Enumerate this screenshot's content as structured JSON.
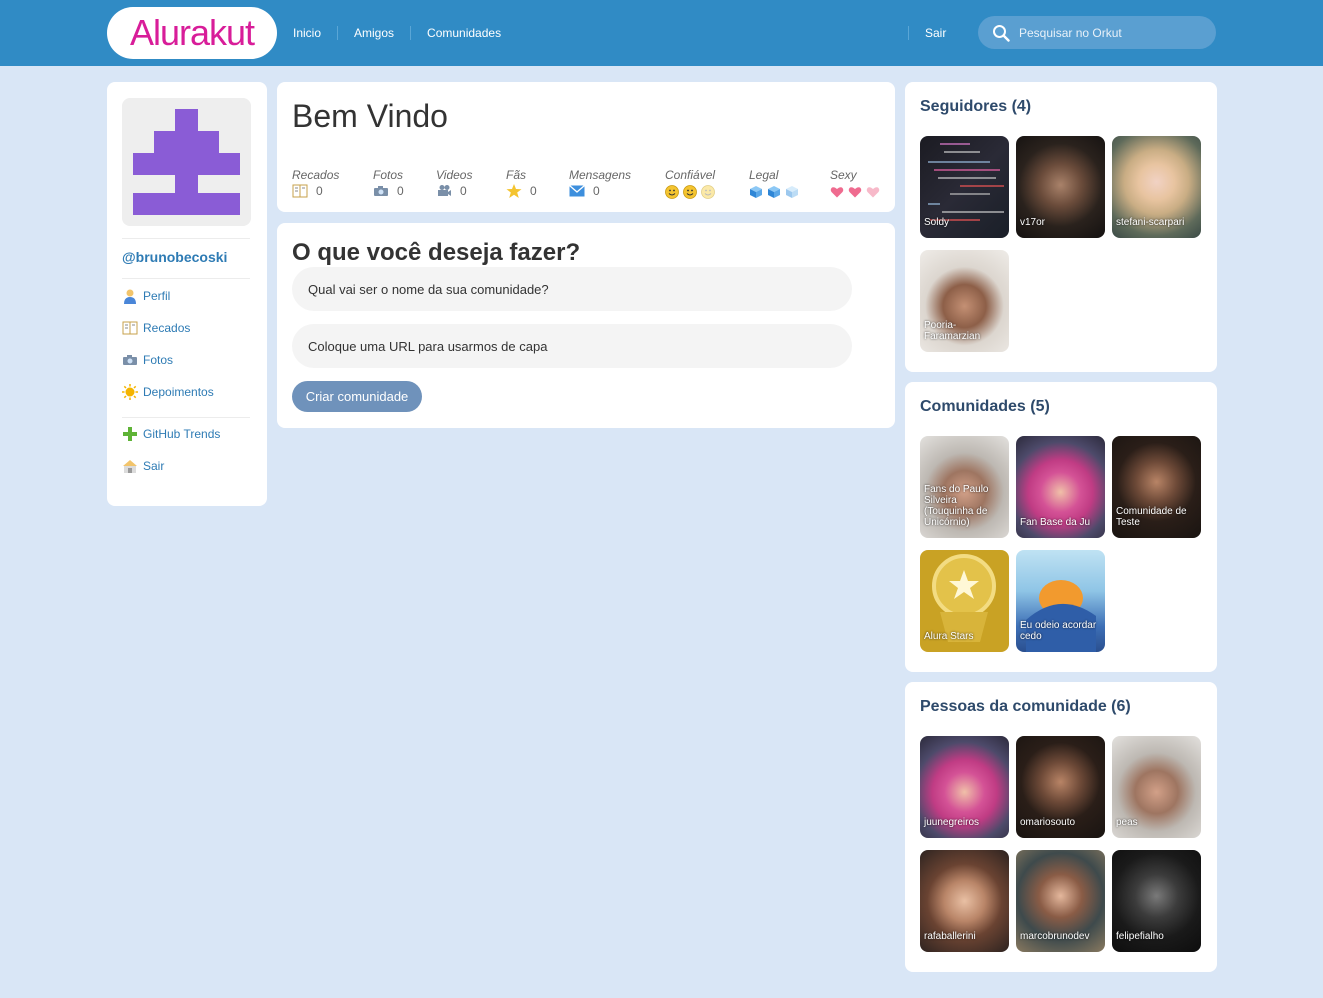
{
  "header": {
    "logo_text": "Alurakut",
    "nav": [
      "Inicio",
      "Amigos",
      "Comunidades"
    ],
    "logout": "Sair",
    "search_placeholder": "Pesquisar no Orkut"
  },
  "sidebar": {
    "username": "@brunobecoski",
    "menu": [
      {
        "label": "Perfil",
        "icon": "user-icon"
      },
      {
        "label": "Recados",
        "icon": "book-icon"
      },
      {
        "label": "Fotos",
        "icon": "camera-icon"
      },
      {
        "label": "Depoimentos",
        "icon": "sun-icon"
      }
    ],
    "menu2": [
      {
        "label": "GitHub Trends",
        "icon": "plus-icon"
      },
      {
        "label": "Sair",
        "icon": "home-icon"
      }
    ]
  },
  "welcome": {
    "title": "Bem Vindo",
    "stats": [
      {
        "label": "Recados",
        "value": "0",
        "icon": "book-icon"
      },
      {
        "label": "Fotos",
        "value": "0",
        "icon": "camera-icon"
      },
      {
        "label": "Videos",
        "value": "0",
        "icon": "video-icon"
      },
      {
        "label": "Fãs",
        "value": "0",
        "icon": "star-icon"
      },
      {
        "label": "Mensagens",
        "value": "0",
        "icon": "mail-icon"
      }
    ],
    "ratings": [
      {
        "label": "Confiável",
        "icon": "smiley-icon",
        "filled": 2,
        "total": 3
      },
      {
        "label": "Legal",
        "icon": "cube-icon",
        "filled": 2,
        "total": 3
      },
      {
        "label": "Sexy",
        "icon": "heart-icon",
        "filled": 2,
        "total": 3
      }
    ]
  },
  "form": {
    "title": "O que você deseja fazer?",
    "name_placeholder": "Qual vai ser o nome da sua comunidade?",
    "url_placeholder": "Coloque uma URL para usarmos de capa",
    "submit": "Criar comunidade"
  },
  "followers": {
    "title": "Seguidores (4)",
    "items": [
      "Soldy",
      "v17or",
      "stefani-scarpari",
      "Pooria-Faramarzian"
    ]
  },
  "communities": {
    "title": "Comunidades (5)",
    "items": [
      "Fans do Paulo Silveira (Touquinha de Unicórnio)",
      "Fan Base da Ju",
      "Comunidade de Teste",
      "Alura Stars",
      "Eu odeio acordar cedo"
    ]
  },
  "people": {
    "title": "Pessoas da comunidade (6)",
    "items": [
      "juunegreiros",
      "omariosouto",
      "peas",
      "rafaballerini",
      "marcobrunodev",
      "felipefialho"
    ]
  },
  "colors": {
    "header": "#308bc5",
    "logo": "#d81d99",
    "link": "#2e7bb4",
    "avatar": "#8a5cd6",
    "button": "#6f92bb"
  }
}
